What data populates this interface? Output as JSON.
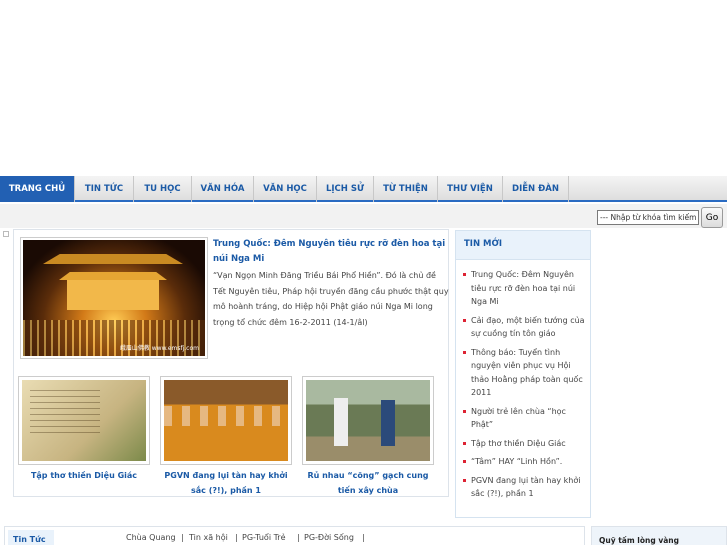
{
  "nav": {
    "items": [
      {
        "label": "TRANG CHỦ",
        "active": true
      },
      {
        "label": "TIN TỨC"
      },
      {
        "label": "TU HỌC"
      },
      {
        "label": "VĂN HÓA"
      },
      {
        "label": "VĂN HỌC"
      },
      {
        "label": "LỊCH SỬ"
      },
      {
        "label": "TỪ THIỆN"
      },
      {
        "label": "THƯ VIỆN"
      },
      {
        "label": "DIỄN ĐÀN"
      }
    ]
  },
  "search": {
    "value": "--- Nhập từ khóa tìm kiếm ---",
    "button": "Go"
  },
  "featured": {
    "title": "Trung Quốc: Đêm Nguyên tiêu rực rỡ đèn hoa tại núi Nga Mi",
    "desc": "“Vạn Ngọn Minh Đăng Triều Bái Phổ Hiền”. Đó là chủ đề Tết Nguyên tiêu, Pháp hội truyền đăng cầu phước thật quy mô hoành tráng, do Hiệp hội Phật giáo núi Nga Mi long trọng tổ chức đêm 16-2-2011 (14-1/âl)",
    "image_mark": "峨眉山佛教 www.emsfj.com"
  },
  "thumbs": [
    {
      "caption": "Tập thơ thiền Diệu Giác"
    },
    {
      "caption": "PGVN đang lụi tàn hay khởi sắc (?!), phần 1"
    },
    {
      "caption": "Rủ nhau “cõng” gạch cung tiến xây chùa"
    }
  ],
  "tinmoi": {
    "title": "TIN MỚI",
    "items": [
      "Trung Quốc: Đêm Nguyên tiêu rực rỡ đèn hoa tại núi Nga Mi",
      "Cải đạo, một biến tướng của sự cuồng tín tôn giáo",
      "Thông báo: Tuyển tình nguyện viên phục vụ Hội thảo Hoằng pháp toàn quốc 2011",
      "Người trẻ lên chùa “học Phật”",
      "Tập thơ thiền Diệu Giác",
      "“Tâm” HAY “Linh Hồn”.",
      "PGVN đang lụi tàn hay khởi sắc (?!), phần 1"
    ]
  },
  "bottom": {
    "tab": "Tin Tức",
    "links": [
      "Chùa Quang",
      "Tin xã hội",
      "PG-Tuổi Trẻ",
      "PG-Đời Sống"
    ],
    "side_title": "Quỹ tấm lòng vàng"
  }
}
